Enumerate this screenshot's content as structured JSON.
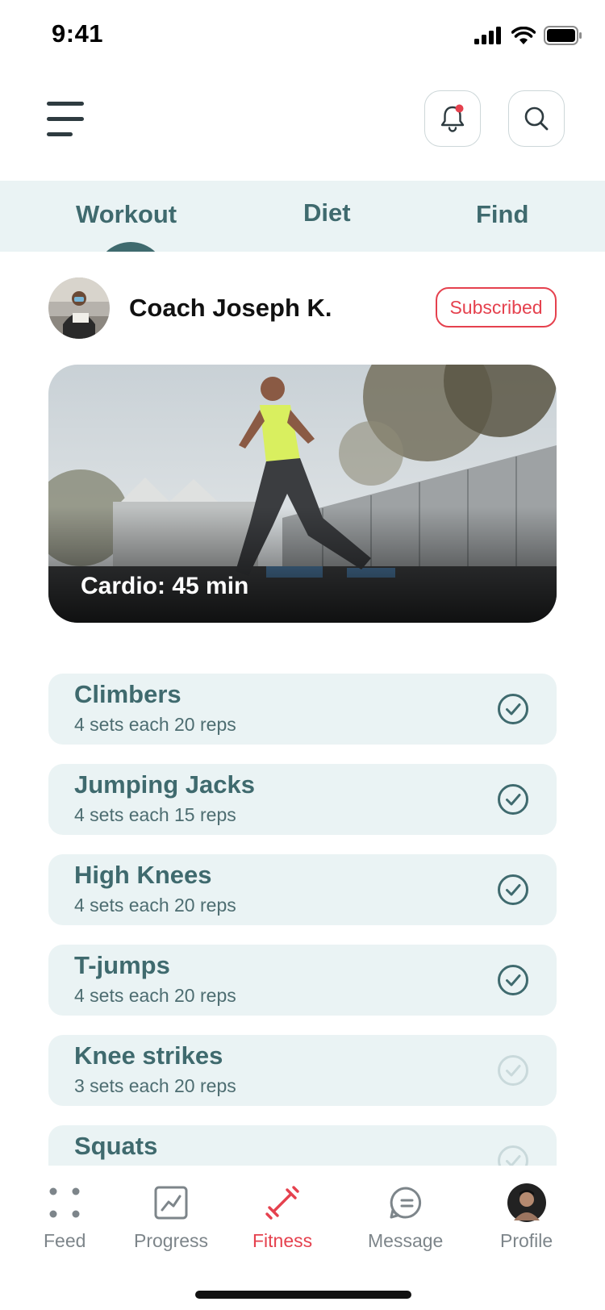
{
  "status": {
    "time": "9:41"
  },
  "tabs": [
    {
      "label": "Workout",
      "active": true
    },
    {
      "label": "Diet",
      "active": false
    },
    {
      "label": "Find",
      "active": false
    }
  ],
  "coach": {
    "name": "Coach Joseph K.",
    "subscribe_label": "Subscribed"
  },
  "hero": {
    "caption": "Cardio: 45 min"
  },
  "exercises": [
    {
      "name": "Climbers",
      "detail": "4 sets each 20 reps",
      "done": true
    },
    {
      "name": "Jumping Jacks",
      "detail": "4 sets each 15 reps",
      "done": true
    },
    {
      "name": "High Knees",
      "detail": "4 sets each 20 reps",
      "done": true
    },
    {
      "name": "T-jumps",
      "detail": "4 sets each 20 reps",
      "done": true
    },
    {
      "name": "Knee strikes",
      "detail": "3 sets each 20 reps",
      "done": false
    },
    {
      "name": "Squats",
      "detail": "",
      "done": false
    }
  ],
  "nav": [
    {
      "label": "Feed",
      "icon": "feed-icon",
      "active": false
    },
    {
      "label": "Progress",
      "icon": "progress-chart-icon",
      "active": false
    },
    {
      "label": "Fitness",
      "icon": "dumbbell-icon",
      "active": true
    },
    {
      "label": "Message",
      "icon": "message-icon",
      "active": false
    },
    {
      "label": "Profile",
      "icon": "avatar",
      "active": false
    }
  ],
  "colors": {
    "accent": "#e5414e",
    "primary": "#3f6a6e",
    "surface": "#eaf3f4",
    "notification_dot": "#e5414e"
  }
}
